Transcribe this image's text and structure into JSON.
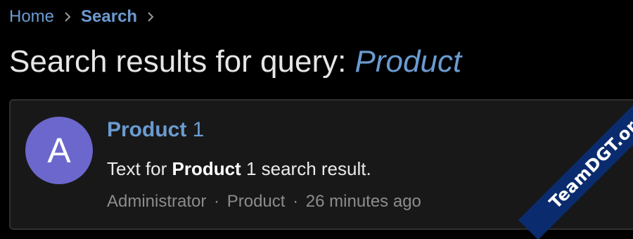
{
  "breadcrumb": {
    "items": [
      {
        "label": "Home"
      },
      {
        "label": "Search"
      }
    ],
    "separator_icon": "chevron-right-icon"
  },
  "page_title": {
    "prefix": "Search results for query: ",
    "query": "Product"
  },
  "results": [
    {
      "avatar_letter": "A",
      "title_highlight": "Product",
      "title_rest": " 1",
      "snippet_prefix": "Text for ",
      "snippet_highlight": "Product",
      "snippet_rest": " 1 search result.",
      "meta": {
        "author": "Administrator",
        "separator": "·",
        "category": "Product",
        "time": "26 minutes ago"
      }
    }
  ],
  "watermark": {
    "text": "TeamDGT.org"
  },
  "colors": {
    "background": "#000000",
    "card_background": "#181818",
    "card_border": "#2f2f2f",
    "link": "#6b9bd1",
    "avatar": "#6b67cc",
    "muted_text": "#8c8c8c",
    "watermark_bg": "#0a2c6e"
  }
}
